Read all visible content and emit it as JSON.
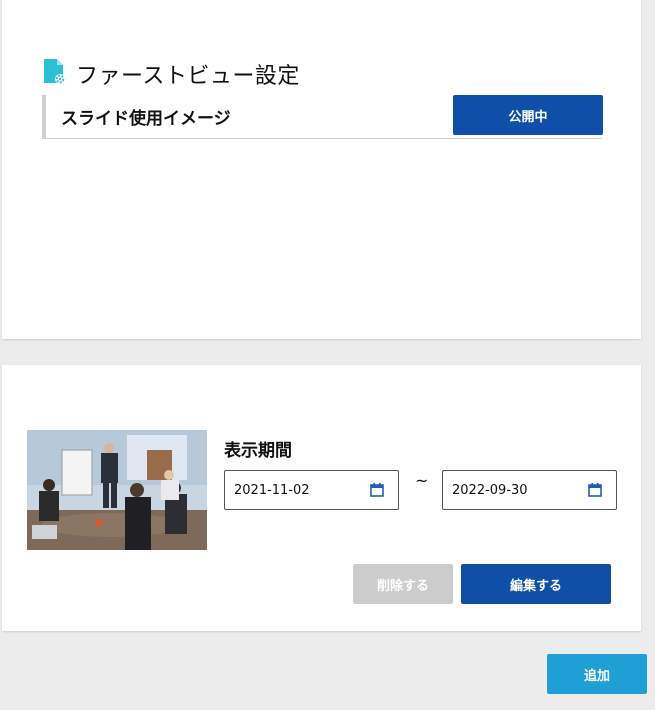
{
  "header": {
    "title": "ファーストビュー設定",
    "icon": "document-gear-icon"
  },
  "section": {
    "label": "スライド使用イメージ",
    "status_button": "公開中"
  },
  "slide": {
    "period_label": "表示期間",
    "start_date": "2021-11-02",
    "end_date": "2022-09-30",
    "separator": "~",
    "delete_button": "削除する",
    "edit_button": "編集する"
  },
  "footer": {
    "add_button": "追加"
  },
  "colors": {
    "primary": "#0f4fa8",
    "accent": "#1e9fd6",
    "disabled": "#cccccc",
    "icon_teal": "#2cc0d3"
  }
}
